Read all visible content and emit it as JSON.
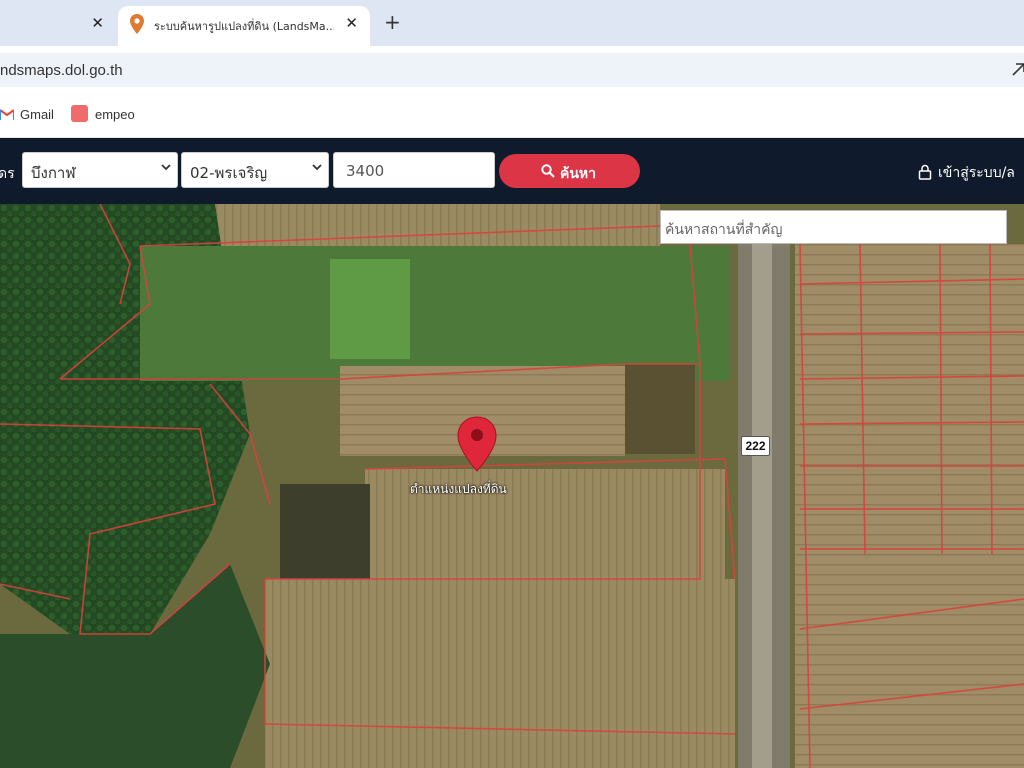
{
  "browser": {
    "active_tab_title": "ระบบค้นหารูปแปลงที่ดิน (LandsMa...",
    "url": "ndsmaps.dol.go.th",
    "bookmarks": [
      "Gmail",
      "empeo"
    ]
  },
  "header": {
    "label": "ดร",
    "province_select": "บึงกาฬ",
    "district_select": "02-พรเจริญ",
    "parcel_number": "3400",
    "search_button": "ค้นหา",
    "login_label": "เข้าสู่ระบบ/ล"
  },
  "map": {
    "place_search_placeholder": "ค้นหาสถานที่สำคัญ",
    "marker_label": "ตำแหน่งแปลงที่ดิน",
    "road_number": "222",
    "marker_color": "#e0263a",
    "boundary_color": "#d8413f"
  }
}
